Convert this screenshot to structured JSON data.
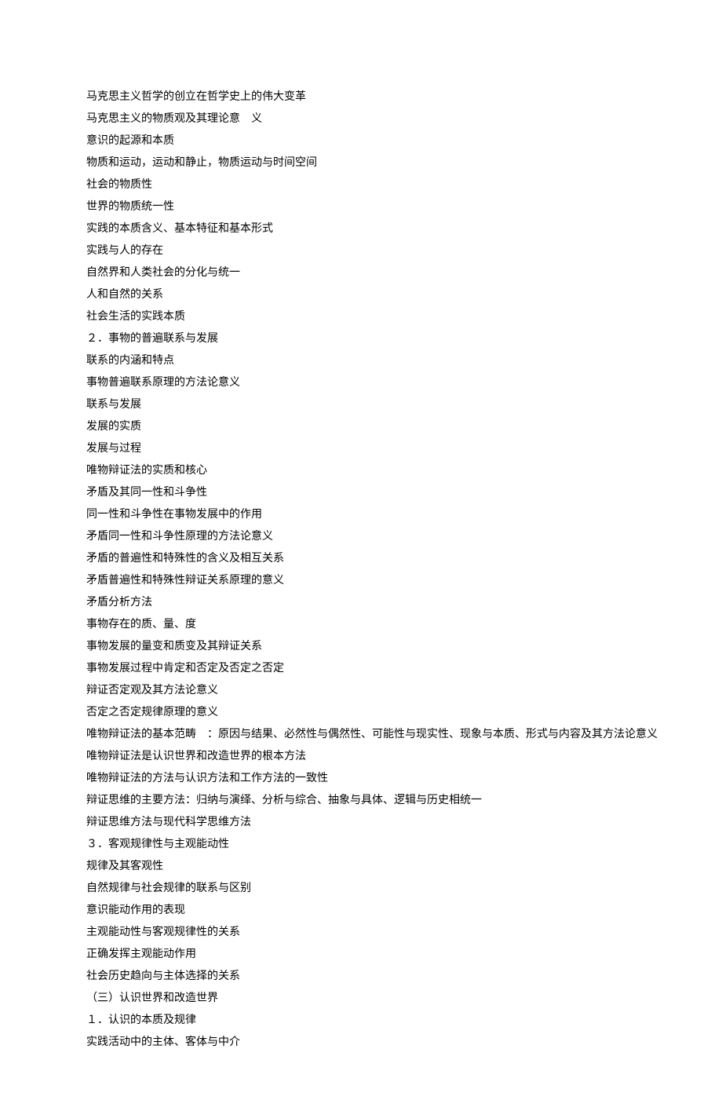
{
  "lines": [
    "马克思主义哲学的创立在哲学史上的伟大变革",
    "马克思主义的物质观及其理论意　义",
    "意识的起源和本质",
    "物质和运动，运动和静止，物质运动与时间空间",
    "社会的物质性",
    "世界的物质统一性",
    "实践的本质含义、基本特征和基本形式",
    "实践与人的存在",
    "自然界和人类社会的分化与统一",
    "人和自然的关系",
    "社会生活的实践本质",
    "２．事物的普遍联系与发展",
    "联系的内涵和特点",
    "事物普遍联系原理的方法论意义",
    "联系与发展",
    "发展的实质",
    "发展与过程",
    "唯物辩证法的实质和核心",
    "矛盾及其同一性和斗争性",
    "同一性和斗争性在事物发展中的作用",
    "矛盾同一性和斗争性原理的方法论意义",
    "矛盾的普遍性和特殊性的含义及相互关系",
    "矛盾普遍性和特殊性辩证关系原理的意义",
    "矛盾分析方法",
    "事物存在的质、量、度",
    "事物发展的量变和质变及其辩证关系",
    "事物发展过程中肯定和否定及否定之否定",
    "辩证否定观及其方法论意义",
    "否定之否定规律原理的意义",
    "唯物辩证法的基本范畴　：原因与结果、必然性与偶然性、可能性与现实性、现象与本质、形式与内容及其方法论意义",
    "唯物辩证法是认识世界和改造世界的根本方法",
    "唯物辩证法的方法与认识方法和工作方法的一致性",
    "辩证思维的主要方法：归纳与演绎、分析与综合、抽象与具体、逻辑与历史相统一",
    "辩证思维方法与现代科学思维方法",
    "３．客观规律性与主观能动性",
    "规律及其客观性",
    "自然规律与社会规律的联系与区别",
    "意识能动作用的表现",
    "主观能动性与客观规律性的关系",
    "正确发挥主观能动作用",
    "社会历史趋向与主体选择的关系",
    "（三）认识世界和改造世界",
    "１．认识的本质及规律",
    "实践活动中的主体、客体与中介"
  ]
}
